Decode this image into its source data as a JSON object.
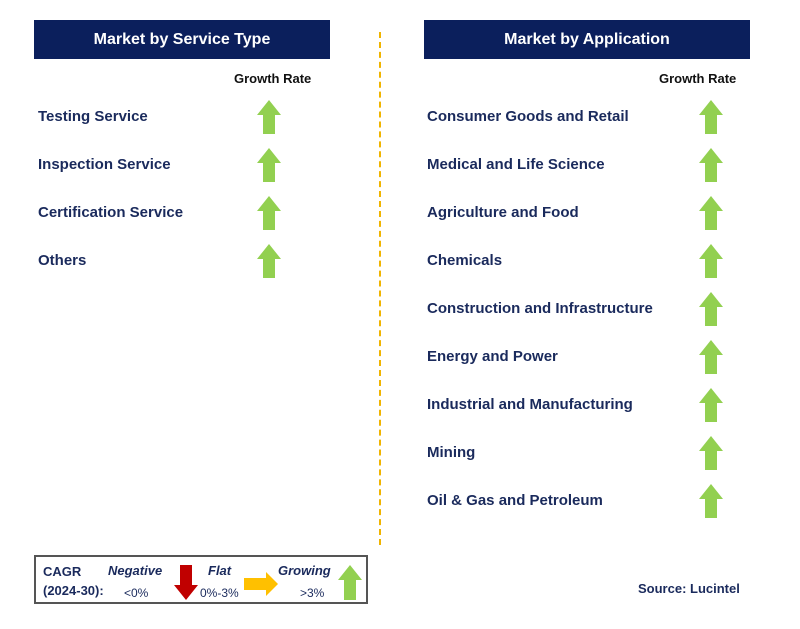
{
  "left": {
    "title": "Market by Service Type",
    "growth_label": "Growth Rate",
    "items": [
      {
        "label": "Testing Service",
        "trend": "growing"
      },
      {
        "label": "Inspection Service",
        "trend": "growing"
      },
      {
        "label": "Certification Service",
        "trend": "growing"
      },
      {
        "label": "Others",
        "trend": "growing"
      }
    ]
  },
  "right": {
    "title": "Market by Application",
    "growth_label": "Growth Rate",
    "items": [
      {
        "label": "Consumer Goods and Retail",
        "trend": "growing"
      },
      {
        "label": "Medical and Life Science",
        "trend": "growing"
      },
      {
        "label": "Agriculture and Food",
        "trend": "growing"
      },
      {
        "label": "Chemicals",
        "trend": "growing"
      },
      {
        "label": "Construction and Infrastructure",
        "trend": "growing"
      },
      {
        "label": "Energy and Power",
        "trend": "growing"
      },
      {
        "label": "Industrial and Manufacturing",
        "trend": "growing"
      },
      {
        "label": "Mining",
        "trend": "growing"
      },
      {
        "label": "Oil & Gas and Petroleum",
        "trend": "growing"
      }
    ]
  },
  "legend": {
    "cagr": "CAGR",
    "period": "(2024-30):",
    "negative": "Negative",
    "negative_range": "<0%",
    "flat": "Flat",
    "flat_range": "0%-3%",
    "growing": "Growing",
    "growing_range": ">3%"
  },
  "source": "Source: Lucintel",
  "colors": {
    "header": "#0b1f5c",
    "growing": "#92d050",
    "flat": "#ffc000",
    "negative": "#c00000",
    "divider": "#f0b400"
  }
}
